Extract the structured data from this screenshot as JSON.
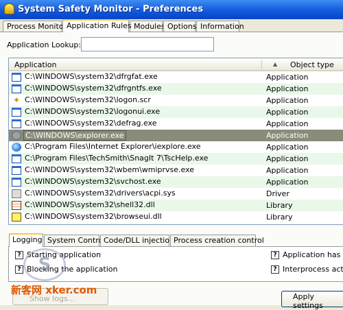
{
  "window": {
    "title": "System Safety Monitor - Preferences"
  },
  "tabs": [
    "Process Monitor",
    "Application Rules",
    "Modules",
    "Options",
    "Information"
  ],
  "lookup": {
    "label": "Application Lookup:",
    "value": ""
  },
  "list": {
    "columns": {
      "application": "Application",
      "object_type": "Object type"
    },
    "rows": [
      {
        "icon": "app-window-icon",
        "path": "C:\\WINDOWS\\system32\\dfrgfat.exe",
        "type": "Application"
      },
      {
        "icon": "app-window-icon",
        "path": "C:\\WINDOWS\\system32\\dfrgntfs.exe",
        "type": "Application"
      },
      {
        "icon": "screensaver-icon",
        "path": "C:\\WINDOWS\\system32\\logon.scr",
        "type": "Application"
      },
      {
        "icon": "app-window-icon",
        "path": "C:\\WINDOWS\\system32\\logonui.exe",
        "type": "Application"
      },
      {
        "icon": "app-window-icon",
        "path": "C:\\WINDOWS\\system32\\defrag.exe",
        "type": "Application"
      },
      {
        "icon": "explorer-icon",
        "path": "C:\\WINDOWS\\explorer.exe",
        "type": "Application"
      },
      {
        "icon": "internet-explorer-icon",
        "path": "C:\\Program Files\\Internet Explorer\\iexplore.exe",
        "type": "Application"
      },
      {
        "icon": "app-window-icon",
        "path": "C:\\Program Files\\TechSmith\\SnagIt 7\\TscHelp.exe",
        "type": "Application"
      },
      {
        "icon": "app-window-icon",
        "path": "C:\\WINDOWS\\system32\\wbem\\wmiprvse.exe",
        "type": "Application"
      },
      {
        "icon": "app-window-icon",
        "path": "C:\\WINDOWS\\system32\\svchost.exe",
        "type": "Application"
      },
      {
        "icon": "driver-icon",
        "path": "C:\\WINDOWS\\system32\\drivers\\acpi.sys",
        "type": "Driver"
      },
      {
        "icon": "dll-icon",
        "path": "C:\\WINDOWS\\system32\\shell32.dll",
        "type": "Library"
      },
      {
        "icon": "dll-icon",
        "path": "C:\\WINDOWS\\system32\\browseui.dll",
        "type": "Library"
      }
    ],
    "selected_index": 5
  },
  "bottom_tabs": [
    "Logging",
    "System Control",
    "Code/DLL injection",
    "Process creation control"
  ],
  "logging_options": {
    "starting_application": "Starting application",
    "blocking_application": "Blocking the application",
    "application_has_been": "Application has bee",
    "interprocess_activity": "Interprocess activit"
  },
  "footer": {
    "show_logs": "Show logs...",
    "apply_settings": "Apply settings",
    "watermark": "新客网 xker.com"
  },
  "colors": {
    "title_bar": "#0b4fd4",
    "alt_row": "#eaf8ea",
    "selected_row": "#8a8c7a",
    "tab_highlight": "#ffc73c"
  }
}
